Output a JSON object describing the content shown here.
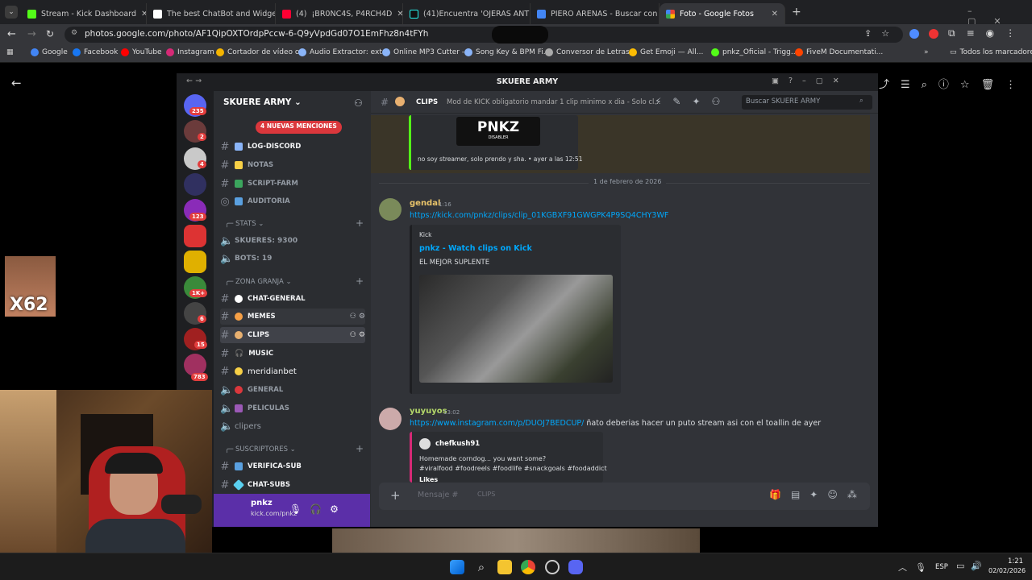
{
  "browser": {
    "tabs": [
      {
        "title": "Stream - Kick Dashboard",
        "color": "#53fc18"
      },
      {
        "title": "The best ChatBot and Widgets",
        "color": "#ffffff"
      },
      {
        "title": "(4) ‍ ¡BR0NC4S, P4RCH4D",
        "color": "#ff0000"
      },
      {
        "title": "(41)Encuentra 'OJERAS ANTES",
        "color": "#000000"
      },
      {
        "title": "PIERO ARENAS - Buscar con Go",
        "color": "#4285f4"
      },
      {
        "title": "Foto - Google Fotos",
        "color": "#fbbc04"
      }
    ],
    "url": "photos.google.com/photo/AF1QipOXTOrdpPccw-6-Q9yVpdGd07O1EmFhz8n4tFYh",
    "bookmarks": [
      "Google",
      "Facebook",
      "YouTube",
      "Instagram",
      "Cortador de vídeo o...",
      "Audio Extractor: ext...",
      "Online MP3 Cutter -...",
      "Song Key & BPM Fi...",
      "Conversor de Letras...",
      "Get Emoji — All...",
      "pnkz_Oficial - Trigg...",
      "FiveM Documentati..."
    ],
    "all_bookmarks": "Todos los marcadores"
  },
  "discord": {
    "window_title": "SKUERE ARMY",
    "server_name": "SKUERE ARMY",
    "server_badges": [
      "235",
      "2",
      "4",
      "123",
      "1K+",
      "6",
      "15",
      "783"
    ],
    "mentions_badge": "4 NUEVAS MENCIONES",
    "channels_top": [
      {
        "name": "LOG-DISCORD",
        "bright": true
      },
      {
        "name": "NOTAS",
        "bright": false
      },
      {
        "name": "SCRIPT-FARM",
        "bright": false
      },
      {
        "name": "AUDITORIA",
        "bright": false
      }
    ],
    "cat_stats": "STATS",
    "stats": [
      "SKUERES: 9300",
      "BOTS: 19"
    ],
    "cat_granja": "ZONA GRANJA",
    "granja": [
      {
        "name": "CHAT-GENERAL",
        "bright": true
      },
      {
        "name": "MEMES",
        "bright": true
      },
      {
        "name": "CLIPS",
        "bright": true
      },
      {
        "name": "MUSIC",
        "bright": true
      },
      {
        "name": "meridianbet",
        "bright": true
      },
      {
        "name": "GENERAL",
        "bright": false
      },
      {
        "name": "PELICULAS",
        "bright": false
      },
      {
        "name": "clipers",
        "bright": false
      }
    ],
    "cat_subs": "SUSCRIPTORES",
    "subs": [
      {
        "name": "VERIFICA-SUB",
        "bright": true
      },
      {
        "name": "CHAT-SUBS",
        "bright": true
      }
    ],
    "user": {
      "name": "pnkz",
      "sub": "kick.com/pnkz"
    },
    "chat": {
      "channel": "CLIPS",
      "topic": "Mod de KICK obligatorio mandar 1 clip minimo x dia - Solo cl...",
      "search_placeholder": "Buscar SKUERE ARMY",
      "top_embed_caption": "no soy streamer, solo prendo y sha. • ayer a las 12:51",
      "top_embed_logo": "PNKZ",
      "top_embed_logo_sub": "DISABLER",
      "date_divider": "1 de febrero de 2026",
      "msg1": {
        "author": "gendal",
        "time": "1:16",
        "link": "https://kick.com/pnkz/clips/clip_01KGBXF91GWGPK4P9SQ4CHY3WF",
        "provider": "Kick",
        "embed_title": "pnkz - Watch clips on Kick",
        "embed_desc": "EL MEJOR SUPLENTE"
      },
      "msg2": {
        "author": "yuyuyos",
        "time": "13:02",
        "link": "https://www.instagram.com/p/DUOJ7BEDCUP/",
        "text": " ñato deberias hacer un puto stream asi con el toallin de ayer",
        "embed_author": "chefkush91",
        "embed_line1": "Homemade corndog... you want some?",
        "embed_line2": "#viralfood #foodreels #foodlife #snackgoals #foodaddict",
        "embed_likes": "Likes"
      },
      "composer_placeholder": "Mensaje #",
      "composer_channel": "CLIPS"
    }
  },
  "overlay": {
    "counter": "X62"
  },
  "taskbar": {
    "lang": "ESP",
    "time": "1:21",
    "date": "02/02/2026"
  }
}
